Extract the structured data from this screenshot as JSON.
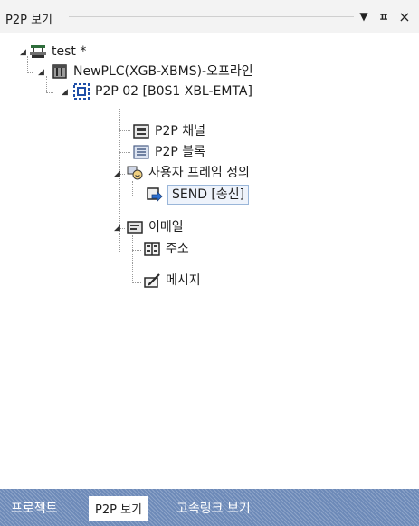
{
  "title_bar": {
    "title": "P2P 보기",
    "dropdown_icon": "▼",
    "pin_icon": "ㅍ",
    "close_icon": "×"
  },
  "tree": {
    "root": {
      "label": "test *",
      "icon": "project-icon"
    },
    "plc": {
      "label": "NewPLC(XGB-XBMS)-오프라인",
      "icon": "plc-icon"
    },
    "p2p": {
      "label": "P2P 02 [B0S1 XBL-EMTA]",
      "icon": "module-icon"
    },
    "channel": {
      "label": "P2P 채널",
      "icon": "channel-icon"
    },
    "block": {
      "label": "P2P 블록",
      "icon": "block-icon"
    },
    "frame": {
      "label": "사용자 프레임 정의",
      "icon": "frame-icon"
    },
    "send": {
      "label": "SEND [송신]",
      "icon": "send-icon"
    },
    "email": {
      "label": "이메일",
      "icon": "email-icon"
    },
    "address": {
      "label": "주소",
      "icon": "address-book-icon"
    },
    "message": {
      "label": "메시지",
      "icon": "message-icon"
    }
  },
  "tabs": [
    {
      "label": "프로젝트"
    },
    {
      "label": "P2P 보기",
      "active": true
    },
    {
      "label": "고속링크 보기"
    }
  ]
}
